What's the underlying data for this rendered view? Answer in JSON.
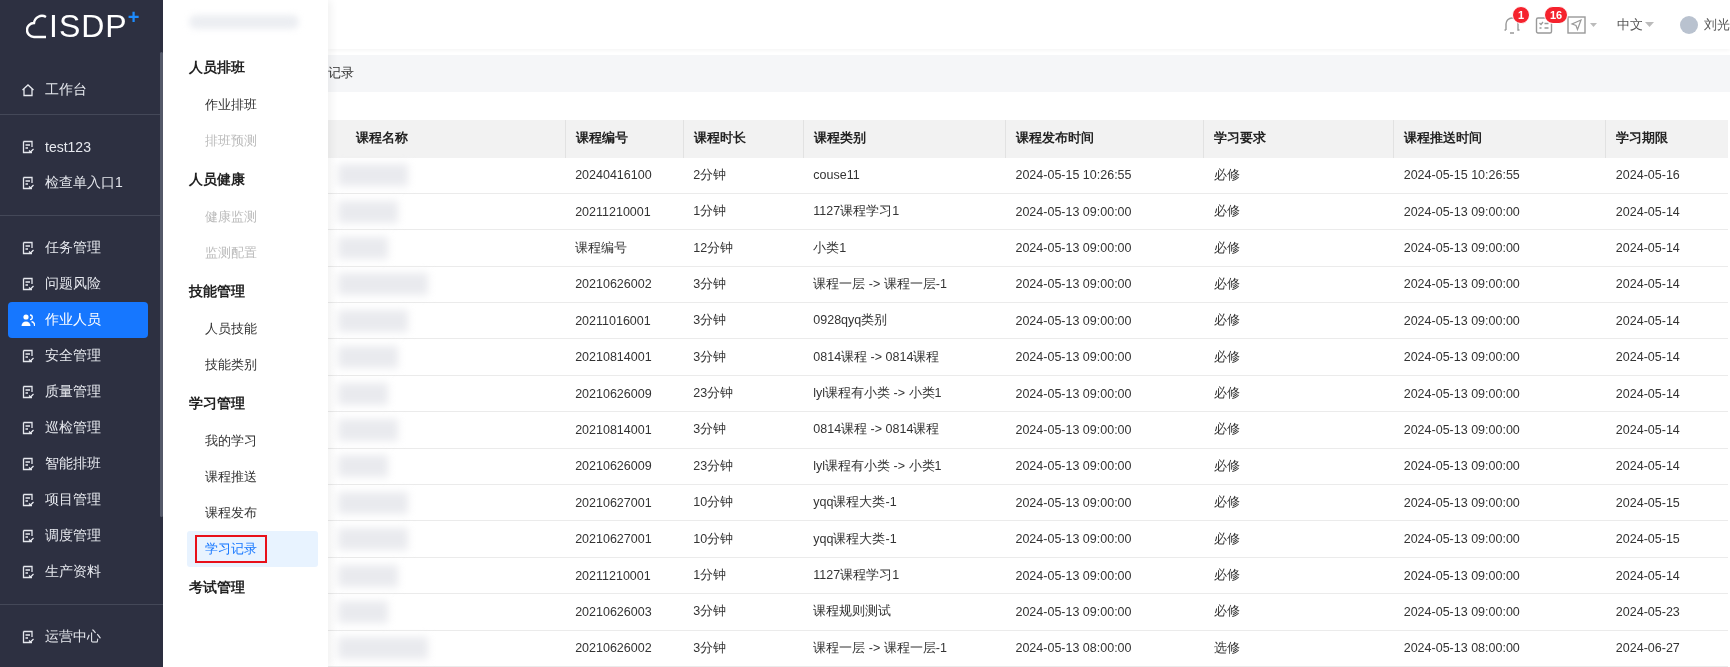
{
  "logo": {
    "text": "ISDP",
    "sup": "+"
  },
  "sidebar": {
    "sections": [
      {
        "items": [
          {
            "label": "工作台",
            "selected": false
          }
        ]
      },
      {
        "items": [
          {
            "label": "test123",
            "selected": false
          },
          {
            "label": "检查单入口1",
            "selected": false
          }
        ]
      },
      {
        "items": [
          {
            "label": "任务管理",
            "selected": false
          },
          {
            "label": "问题风险",
            "selected": false
          },
          {
            "label": "作业人员",
            "selected": true
          },
          {
            "label": "安全管理",
            "selected": false
          },
          {
            "label": "质量管理",
            "selected": false
          },
          {
            "label": "巡检管理",
            "selected": false
          },
          {
            "label": "智能排班",
            "selected": false
          },
          {
            "label": "项目管理",
            "selected": false
          },
          {
            "label": "调度管理",
            "selected": false
          },
          {
            "label": "生产资料",
            "selected": false
          }
        ]
      },
      {
        "items": [
          {
            "label": "运营中心",
            "selected": false
          }
        ]
      }
    ]
  },
  "flyout": {
    "groups": [
      {
        "title": "人员排班",
        "items": [
          {
            "label": "作业排班",
            "disabled": false,
            "selected": false,
            "outlined": false
          },
          {
            "label": "排班预测",
            "disabled": true,
            "selected": false,
            "outlined": false
          }
        ]
      },
      {
        "title": "人员健康",
        "items": [
          {
            "label": "健康监测",
            "disabled": true,
            "selected": false,
            "outlined": false
          },
          {
            "label": "监测配置",
            "disabled": true,
            "selected": false,
            "outlined": false
          }
        ]
      },
      {
        "title": "技能管理",
        "items": [
          {
            "label": "人员技能",
            "disabled": false,
            "selected": false,
            "outlined": false
          },
          {
            "label": "技能类别",
            "disabled": false,
            "selected": false,
            "outlined": false
          }
        ]
      },
      {
        "title": "学习管理",
        "items": [
          {
            "label": "我的学习",
            "disabled": false,
            "selected": false,
            "outlined": false
          },
          {
            "label": "课程推送",
            "disabled": false,
            "selected": false,
            "outlined": false
          },
          {
            "label": "课程发布",
            "disabled": false,
            "selected": false,
            "outlined": false
          },
          {
            "label": "学习记录",
            "disabled": false,
            "selected": true,
            "outlined": true
          }
        ]
      },
      {
        "title": "考试管理"
      }
    ]
  },
  "header": {
    "notifications_badge": "1",
    "tasks_badge": "16",
    "language": "中文",
    "user_name": "刘光"
  },
  "breadcrumb": "记录",
  "table": {
    "columns": [
      "课程名称",
      "课程编号",
      "课程时长",
      "课程类别",
      "课程发布时间",
      "学习要求",
      "课程推送时间",
      "学习期限"
    ],
    "rows": [
      [
        "",
        "20240416100",
        "2分钟",
        "couse11",
        "2024-05-15 10:26:55",
        "必修",
        "2024-05-15 10:26:55",
        "2024-05-16"
      ],
      [
        "",
        "20211210001",
        "1分钟",
        "1127课程学习1",
        "2024-05-13 09:00:00",
        "必修",
        "2024-05-13 09:00:00",
        "2024-05-14"
      ],
      [
        "",
        "课程编号",
        "12分钟",
        "小类1",
        "2024-05-13 09:00:00",
        "必修",
        "2024-05-13 09:00:00",
        "2024-05-14"
      ],
      [
        "",
        "20210626002",
        "3分钟",
        "课程一层 -> 课程一层-1",
        "2024-05-13 09:00:00",
        "必修",
        "2024-05-13 09:00:00",
        "2024-05-14"
      ],
      [
        "",
        "20211016001",
        "3分钟",
        "0928qyq类别",
        "2024-05-13 09:00:00",
        "必修",
        "2024-05-13 09:00:00",
        "2024-05-14"
      ],
      [
        "",
        "20210814001",
        "3分钟",
        "0814课程 -> 0814课程",
        "2024-05-13 09:00:00",
        "必修",
        "2024-05-13 09:00:00",
        "2024-05-14"
      ],
      [
        "",
        "20210626009",
        "23分钟",
        "lyl课程有小类 -> 小类1",
        "2024-05-13 09:00:00",
        "必修",
        "2024-05-13 09:00:00",
        "2024-05-14"
      ],
      [
        "",
        "20210814001",
        "3分钟",
        "0814课程 -> 0814课程",
        "2024-05-13 09:00:00",
        "必修",
        "2024-05-13 09:00:00",
        "2024-05-14"
      ],
      [
        "",
        "20210626009",
        "23分钟",
        "lyl课程有小类 -> 小类1",
        "2024-05-13 09:00:00",
        "必修",
        "2024-05-13 09:00:00",
        "2024-05-14"
      ],
      [
        "",
        "20210627001",
        "10分钟",
        "yqq课程大类-1",
        "2024-05-13 09:00:00",
        "必修",
        "2024-05-13 09:00:00",
        "2024-05-15"
      ],
      [
        "",
        "20210627001",
        "10分钟",
        "yqq课程大类-1",
        "2024-05-13 09:00:00",
        "必修",
        "2024-05-13 09:00:00",
        "2024-05-15"
      ],
      [
        "",
        "20211210001",
        "1分钟",
        "1127课程学习1",
        "2024-05-13 09:00:00",
        "必修",
        "2024-05-13 09:00:00",
        "2024-05-14"
      ],
      [
        "",
        "20210626003",
        "3分钟",
        "课程规则测试",
        "2024-05-13 09:00:00",
        "必修",
        "2024-05-13 09:00:00",
        "2024-05-23"
      ],
      [
        "",
        "20210626002",
        "3分钟",
        "课程一层 -> 课程一层-1",
        "2024-05-13 08:00:00",
        "选修",
        "2024-05-13 08:00:00",
        "2024-06-27"
      ]
    ]
  }
}
